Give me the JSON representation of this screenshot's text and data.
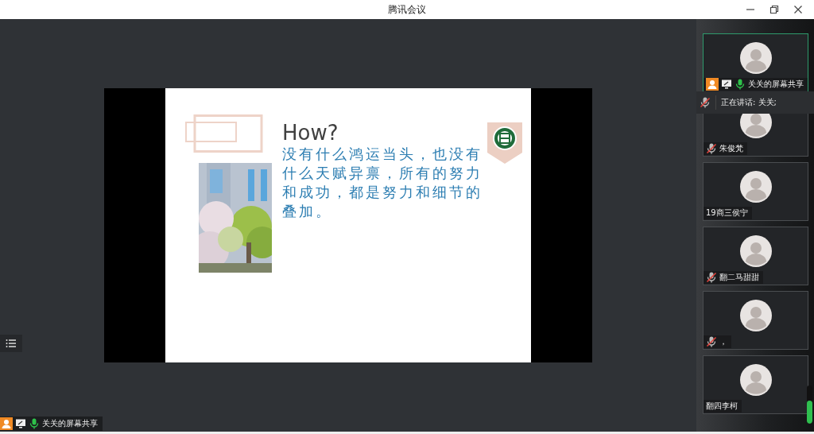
{
  "window": {
    "title": "腾讯会议"
  },
  "slide": {
    "title": "How?",
    "body": "没有什么鸿运当头，也没有什么天赋异禀，所有的努力和成功，都是努力和细节的叠加。"
  },
  "share_label": {
    "text": "关关的屏幕共享",
    "muted": false
  },
  "speaking": {
    "text": "正在讲话: 关关;",
    "muted": true
  },
  "participants": [
    {
      "name": "关关的屏幕共享",
      "muted": false,
      "sharing": true,
      "highlighted": true
    },
    {
      "name": "朱俊梵",
      "muted": true,
      "sharing": false,
      "highlighted": false
    },
    {
      "name": "19商三侯宁",
      "sharing": false,
      "highlighted": false
    },
    {
      "name": "翻二马甜甜",
      "muted": true,
      "sharing": false,
      "highlighted": false
    },
    {
      "name": "，",
      "muted": true,
      "sharing": false,
      "highlighted": false
    },
    {
      "name": "翻四李柯",
      "sharing": false,
      "highlighted": false
    }
  ],
  "volume": {
    "level": 0.6
  }
}
